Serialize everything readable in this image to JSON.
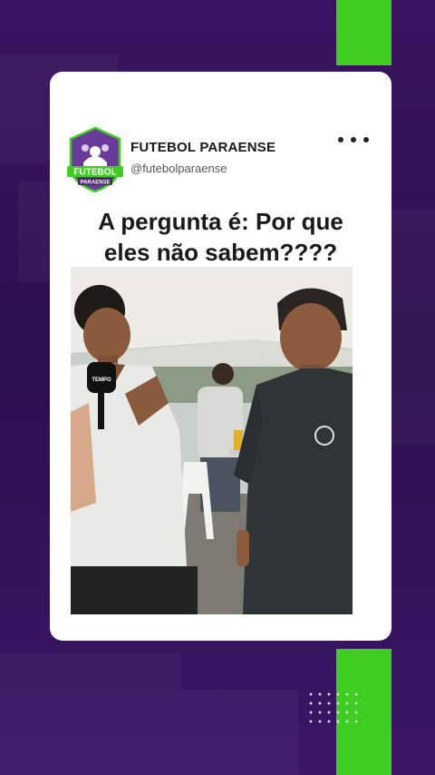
{
  "post": {
    "account_name": "FUTEBOL PARAENSE",
    "account_handle": "@futebolparaense",
    "headline_line1": "A pergunta é: Por que",
    "headline_line2": "eles não sabem????",
    "more_icon": "more-horizontal-icon"
  },
  "logo": {
    "text_main": "FUTEBOL",
    "text_sub": "PARAENSE",
    "colors": {
      "primary": "#6a3a9a",
      "accent": "#3fcd22"
    }
  },
  "video": {
    "mic_label": "TEMPO",
    "colors": {
      "tent": "#ecebe6",
      "ground": "#7d7a74",
      "left_shirt": "#e9e9e7",
      "right_shirt": "#2f3436"
    }
  },
  "colors": {
    "background": "#2c0f4e",
    "accent_green": "#3fcd22",
    "card": "#ffffff"
  }
}
